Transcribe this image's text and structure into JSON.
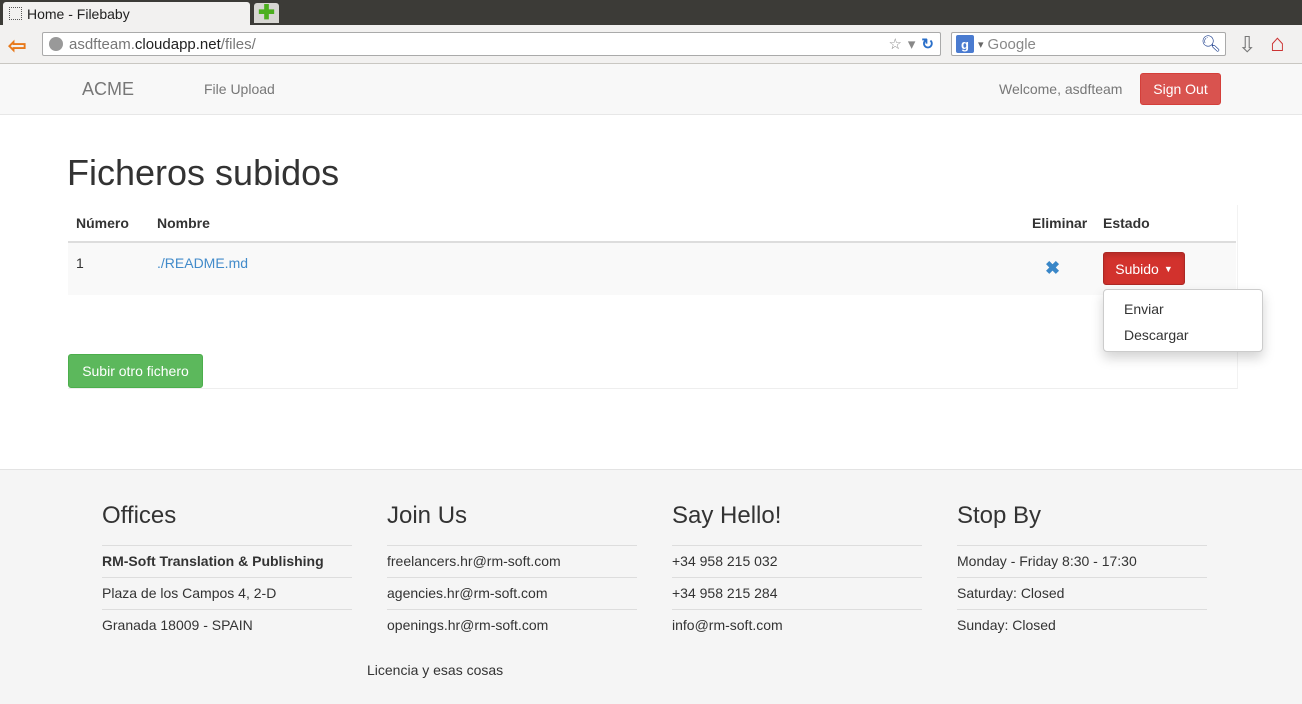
{
  "browser": {
    "tab_title": "Home - Filebaby",
    "url_host_prefix": "asdfteam.",
    "url_host_main": "cloudapp.net",
    "url_path": "/files/",
    "search_placeholder": "Google"
  },
  "nav": {
    "brand": "ACME",
    "link_upload": "File Upload",
    "welcome": "Welcome, asdfteam",
    "signout": "Sign Out"
  },
  "main": {
    "title": "Ficheros subidos",
    "table": {
      "headers": [
        "Número",
        "Nombre",
        "Eliminar",
        "Estado"
      ],
      "rows": [
        {
          "num": "1",
          "name": "./README.md",
          "state": "Subido"
        }
      ]
    },
    "dropdown": [
      "Enviar",
      "Descargar"
    ],
    "upload_button": "Subir otro fichero"
  },
  "footer": {
    "offices": {
      "title": "Offices",
      "items": [
        "RM-Soft Translation & Publishing",
        "Plaza de los Campos 4, 2-D",
        "Granada 18009 - SPAIN"
      ]
    },
    "join": {
      "title": "Join Us",
      "items": [
        "freelancers.hr@rm-soft.com",
        "agencies.hr@rm-soft.com",
        "openings.hr@rm-soft.com"
      ]
    },
    "hello": {
      "title": "Say Hello!",
      "items": [
        "+34 958 215 032",
        "+34 958 215 284",
        "info@rm-soft.com"
      ]
    },
    "stopby": {
      "title": "Stop By",
      "items": [
        "Monday - Friday 8:30 - 17:30",
        "Saturday: Closed",
        "Sunday: Closed"
      ]
    },
    "license": "Licencia y esas cosas"
  },
  "colors": {
    "danger": "#d9534f",
    "success": "#5cb85c",
    "link": "#428bca"
  }
}
